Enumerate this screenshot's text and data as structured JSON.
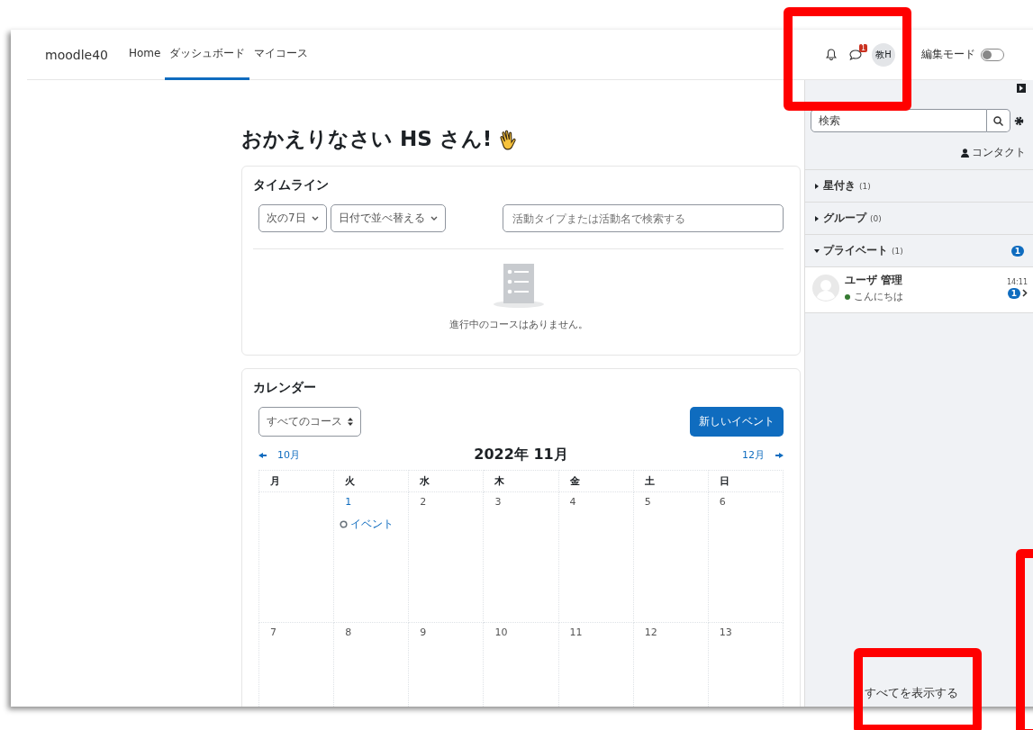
{
  "nav": {
    "brand": "moodle40",
    "items": [
      {
        "label": "Home",
        "selected": false
      },
      {
        "label": "ダッシュボード",
        "selected": true
      },
      {
        "label": "マイコース",
        "selected": false
      }
    ],
    "message_badge": "1",
    "avatar": "教H",
    "edit_mode": {
      "label": "編集モード",
      "on": false
    }
  },
  "heading": "おかえりなさい HS さん!",
  "timeline": {
    "title": "タイムライン",
    "filters": [
      "次の7日",
      "日付で並べ替える"
    ],
    "search": {
      "placeholder": "活動タイプまたは活動名で検索する"
    },
    "empty": "進行中のコースはありません。"
  },
  "calendar": {
    "title": "カレンダー",
    "course_select": "すべてのコース",
    "new_event": "新しいイベント",
    "prev": "10月",
    "month": "2022年 11月",
    "next": "12月",
    "weekdays": [
      "月",
      "火",
      "水",
      "木",
      "金",
      "土",
      "日"
    ],
    "weeks": [
      [
        {
          "kind": "blank"
        },
        {
          "day": "1",
          "events": [
            "イベント"
          ]
        },
        {
          "day": "2"
        },
        {
          "day": "3"
        },
        {
          "day": "4"
        },
        {
          "day": "5"
        },
        {
          "day": "6"
        }
      ],
      [
        {
          "day": "7"
        },
        {
          "day": "8"
        },
        {
          "day": "9"
        },
        {
          "day": "10"
        },
        {
          "day": "11"
        },
        {
          "day": "12"
        },
        {
          "day": "13"
        }
      ]
    ]
  },
  "drawer": {
    "search": {
      "placeholder": "検索"
    },
    "contacts_link": "コンタクト",
    "sections": [
      {
        "label": "星付き",
        "count": "(1)",
        "expanded": false
      },
      {
        "label": "グループ",
        "count": "(0)",
        "expanded": false
      },
      {
        "label": "プライベート",
        "count": "(1)",
        "expanded": true,
        "badge": "1"
      }
    ],
    "conversations": [
      {
        "name": "ユーザ 管理",
        "message": "こんにちは",
        "time": "14:11",
        "unread": "1",
        "online": true
      }
    ],
    "view_all": "すべてを表示する"
  }
}
